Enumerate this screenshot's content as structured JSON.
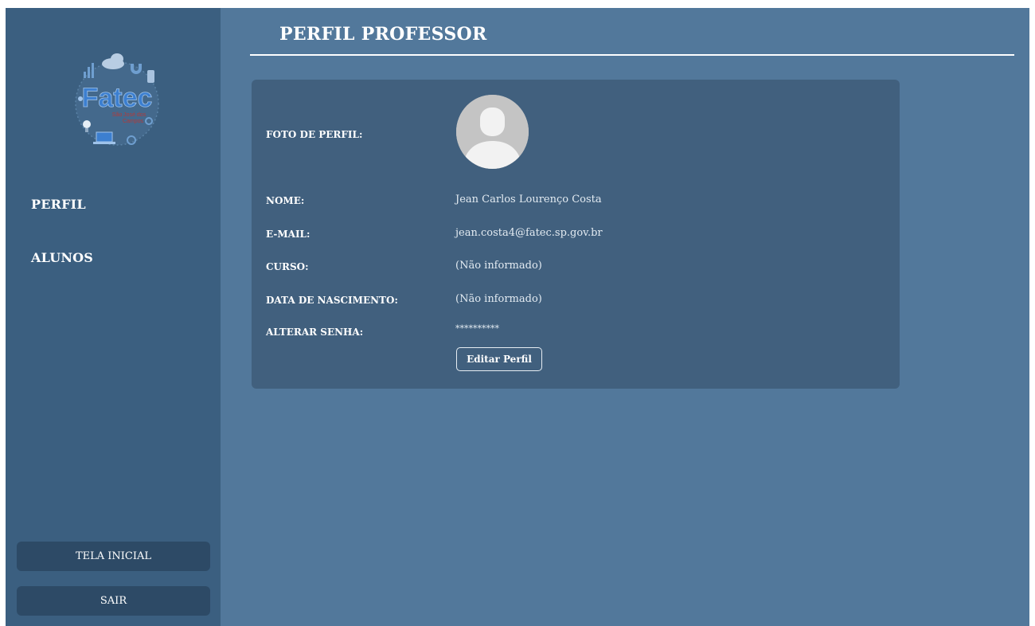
{
  "page": {
    "title": "PERFIL PROFESSOR"
  },
  "sidebar": {
    "logo": {
      "brand_text": "Fatec",
      "sub_text": "São José dos Campos",
      "icon": "fatec-logo-icon"
    },
    "items": [
      {
        "label": "PERFIL"
      },
      {
        "label": "ALUNOS"
      }
    ],
    "buttons": {
      "home": "TELA INICIAL",
      "exit": "SAIR"
    }
  },
  "profile": {
    "photo_label": "FOTO DE PERFIL:",
    "avatar_icon": "user-avatar-icon",
    "name_label": "NOME:",
    "name_value": "Jean Carlos Lourenço Costa",
    "email_label": "E-MAIL:",
    "email_value": "jean.costa4@fatec.sp.gov.br",
    "course_label": "CURSO:",
    "course_value": "(Não informado)",
    "birth_label": "DATA DE NASCIMENTO:",
    "birth_value": "(Não informado)",
    "password_label": "ALTERAR SENHA:",
    "password_value": "**********",
    "edit_button": "Editar Perfil"
  },
  "colors": {
    "background": "#52789b",
    "sidebar": "#3b5f80",
    "card": "#41607e",
    "button_dark": "#2d4a66",
    "text": "#ffffff"
  }
}
